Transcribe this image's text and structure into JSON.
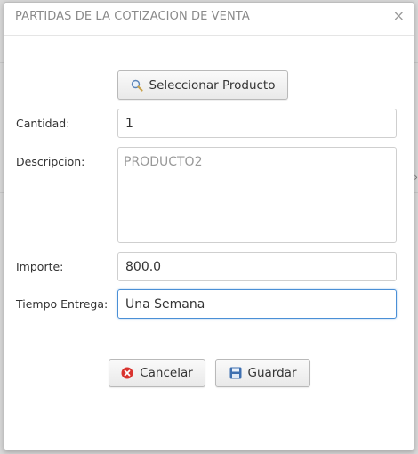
{
  "dialog": {
    "title": "PARTIDAS DE LA COTIZACION DE VENTA",
    "close_glyph": "×"
  },
  "select_product_button": {
    "label": "Seleccionar Producto",
    "icon": "search-icon"
  },
  "form": {
    "cantidad": {
      "label": "Cantidad:",
      "value": "1"
    },
    "descripcion": {
      "label": "Descripcion:",
      "value": "PRODUCTO2"
    },
    "importe": {
      "label": "Importe:",
      "value": "800.0"
    },
    "tiempo_entrega": {
      "label": "Tiempo Entrega:",
      "value": "Una Semana"
    }
  },
  "actions": {
    "cancel": {
      "label": "Cancelar",
      "icon": "cancel-icon",
      "color": "#d9332e"
    },
    "save": {
      "label": "Guardar",
      "icon": "save-icon",
      "color": "#3d6fb0"
    }
  }
}
